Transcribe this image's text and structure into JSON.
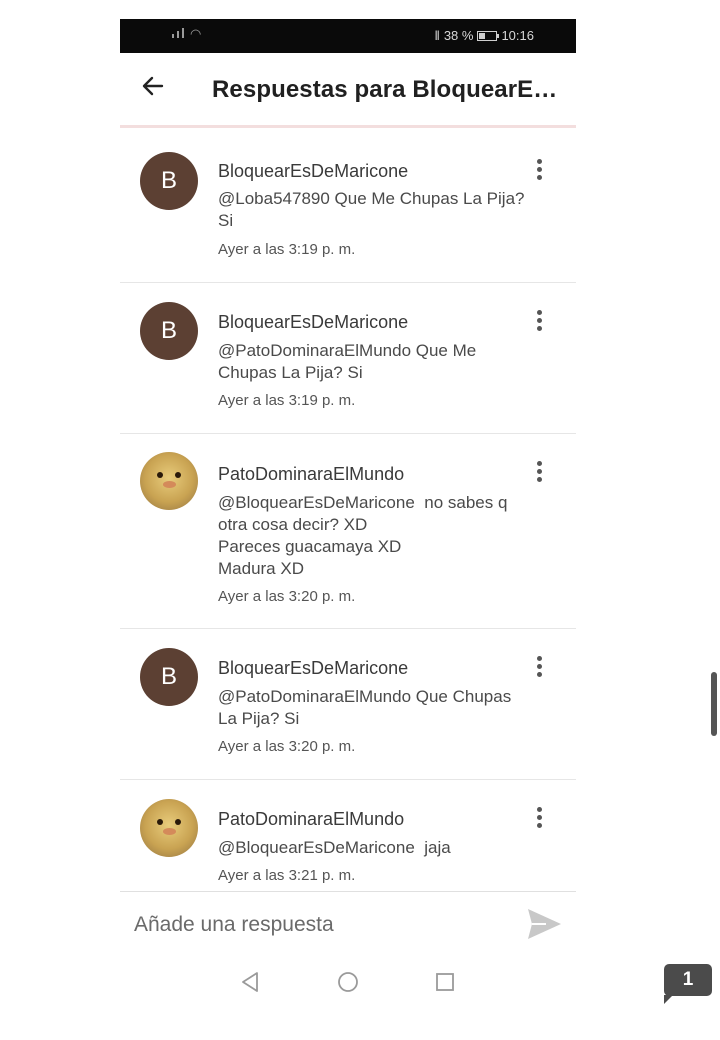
{
  "status_bar": {
    "battery_percent": "38 %",
    "time": "10:16",
    "battery_level": 0.38,
    "icons": [
      "signal-icon",
      "wifi-icon",
      "vibrate-icon",
      "battery-icon"
    ]
  },
  "header": {
    "title": "Respuestas para BloquearE…",
    "back_icon": "arrow-left-icon"
  },
  "replies": [
    {
      "username": "BloquearEsDeMaricone",
      "avatar_letter": "B",
      "avatar_type": "letter",
      "message": "@Loba547890 Que Me Chupas La Pija?\nSi",
      "timestamp": "Ayer a las 3:19 p. m."
    },
    {
      "username": "BloquearEsDeMaricone",
      "avatar_letter": "B",
      "avatar_type": "letter",
      "message": "@PatoDominaraElMundo Que Me\nChupas La Pija? Si",
      "timestamp": "Ayer a las 3:19 p. m."
    },
    {
      "username": "PatoDominaraElMundo",
      "avatar_letter": "",
      "avatar_type": "duck-photo",
      "message": "@BloquearEsDeMaricone  no sabes q\notra cosa decir? XD\nPareces guacamaya XD\nMadura XD",
      "timestamp": "Ayer a las 3:20 p. m."
    },
    {
      "username": "BloquearEsDeMaricone",
      "avatar_letter": "B",
      "avatar_type": "letter",
      "message": "@PatoDominaraElMundo Que Chupas\nLa Pija? Si",
      "timestamp": "Ayer a las 3:20 p. m."
    },
    {
      "username": "PatoDominaraElMundo",
      "avatar_letter": "",
      "avatar_type": "duck-photo",
      "message": "@BloquearEsDeMaricone  jaja",
      "timestamp": "Ayer a las 3:21 p. m."
    }
  ],
  "composer": {
    "placeholder": "Añade una respuesta",
    "send_icon": "send-icon"
  },
  "nav_bar": {
    "icons": [
      "back-triangle-icon",
      "home-circle-icon",
      "recents-square-icon"
    ]
  },
  "page_badge": "1",
  "colors": {
    "avatar_brown": "#5c4033",
    "status_bar_bg": "#0a0a0a",
    "divider": "#e6e6e6",
    "send_icon": "#c8c8c8"
  }
}
